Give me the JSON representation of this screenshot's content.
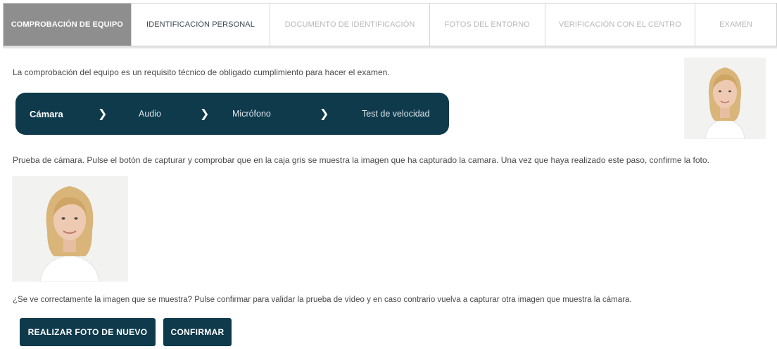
{
  "tabs": [
    {
      "label": "COMPROBACIÓN DE EQUIPO",
      "state": "active"
    },
    {
      "label": "IDENTIFICACIÓN PERSONAL",
      "state": "current"
    },
    {
      "label": "DOCUMENTO DE IDENTIFICACIÓN",
      "state": "disabled"
    },
    {
      "label": "FOTOS DEL ENTORNO",
      "state": "disabled"
    },
    {
      "label": "VERIFICACIÓN CON EL CENTRO",
      "state": "disabled"
    },
    {
      "label": "EXAMEN",
      "state": "disabled"
    }
  ],
  "intro_text": "La comprobación del equipo es un requisito técnico de obligado cumplimiento para hacer el examen.",
  "stepper": {
    "steps": [
      {
        "label": "Cámara",
        "active": true
      },
      {
        "label": "Audio",
        "active": false
      },
      {
        "label": "Micrófono",
        "active": false
      },
      {
        "label": "Test de velocidad",
        "active": false
      }
    ],
    "separator_icon": "chevron-right-icon"
  },
  "camera_instructions": "Prueba de cámara. Pulse el botón de capturar y comprobar que en la caja gris se muestra la imagen que ha capturado la camara. Una vez que haya realizado este paso, confirme la foto.",
  "question_text": "¿Se ve correctamente la imagen que se muestra? Pulse confirmar para validar la prueba de vídeo y en caso contrario vuelva a capturar otra imagen que muestra la cámara.",
  "buttons": {
    "retake_label": "REALIZAR FOTO DE NUEVO",
    "confirm_label": "CONFIRMAR"
  },
  "colors": {
    "primary_dark": "#0e3a4c",
    "active_tab": "#8e8e8e",
    "disabled_tab_text": "#b8b8b8"
  }
}
